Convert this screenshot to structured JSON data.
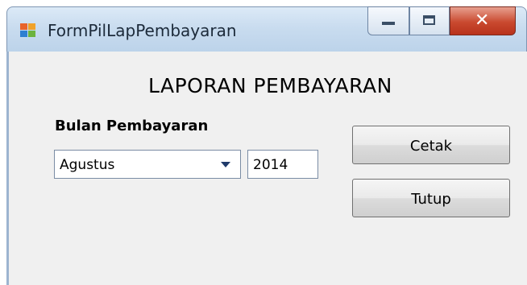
{
  "window": {
    "title": "FormPilLapPembayaran"
  },
  "form": {
    "heading": "LAPORAN PEMBAYARAN",
    "month_label": "Bulan Pembayaran",
    "month_value": "Agustus",
    "year_value": "2014",
    "print_button": "Cetak",
    "close_button": "Tutup"
  },
  "icons": {
    "app": "windows-form-icon",
    "minimize": "minimize-icon",
    "maximize": "maximize-icon",
    "close": "close-icon",
    "dropdown": "chevron-down-icon"
  },
  "colors": {
    "titlebar": "#c9dcef",
    "close_button": "#c9492f",
    "client_background": "#f0f0f0"
  }
}
